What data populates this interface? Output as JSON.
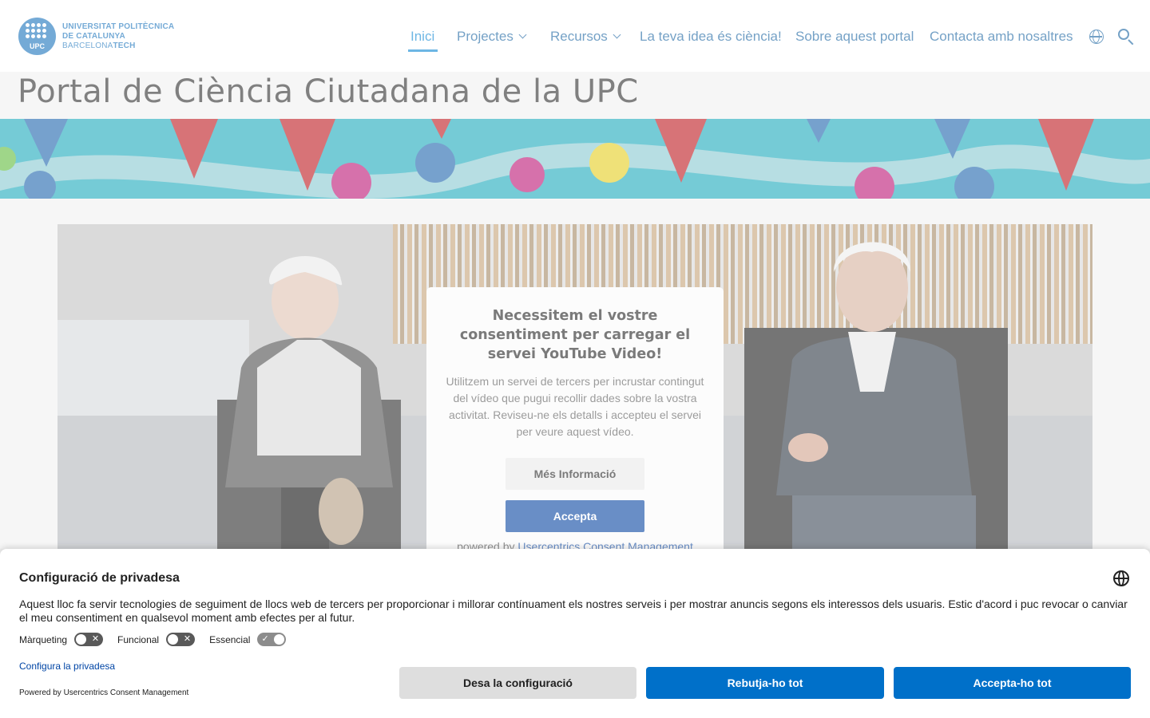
{
  "logo": {
    "line1": "UNIVERSITAT POLITÈCNICA",
    "line2": "DE CATALUNYA",
    "line3a": "BARCELONA",
    "line3b": "TECH",
    "mark": "UPC"
  },
  "nav": {
    "items": [
      {
        "label": "Inici"
      },
      {
        "label": "Projectes"
      },
      {
        "label": "Recursos"
      },
      {
        "label": "La teva idea és ciència!"
      },
      {
        "label": "Sobre aquest portal"
      },
      {
        "label": "Contacta amb nosaltres"
      }
    ],
    "icons": [
      "globe-icon",
      "search-icon"
    ]
  },
  "page": {
    "title": "Portal de Ciència Ciutadana de la UPC"
  },
  "video_consent": {
    "heading": "Necessitem el vostre consentiment per carregar el servei YouTube Video!",
    "body": "Utilitzem un servei de tercers per incrustar contingut del vídeo que pugui recollir dades sobre la vostra activitat. Reviseu-ne els detalls i accepteu el servei per veure aquest vídeo.",
    "more_label": "Més Informació",
    "accept_label": "Accepta",
    "powered_prefix": "powered by",
    "powered_link": "Usercentrics Consent Management Platform"
  },
  "privacy": {
    "title": "Configuració de privadesa",
    "text": "Aquest lloc fa servir tecnologies de seguiment de llocs web de tercers per proporcionar i millorar contínuament els nostres serveis i per mostrar anuncis segons els interessos dels usuaris. Estic d'acord i puc revocar o canviar el meu consentiment en qualsevol moment amb efectes per al futur.",
    "toggles": [
      {
        "label": "Màrqueting",
        "state": "off"
      },
      {
        "label": "Funcional",
        "state": "off"
      },
      {
        "label": "Essencial",
        "state": "on"
      }
    ],
    "config_link": "Configura la privadesa",
    "powered": "Powered by Usercentrics Consent Management",
    "buttons": {
      "save": "Desa la configuració",
      "deny": "Rebutja-ho tot",
      "accept": "Accepta-ho tot"
    }
  },
  "colors": {
    "brand": "#2a7dc0",
    "nav": "#2a6fa8",
    "primary_button": "#0070c9",
    "banner": "#2bb0c1"
  }
}
